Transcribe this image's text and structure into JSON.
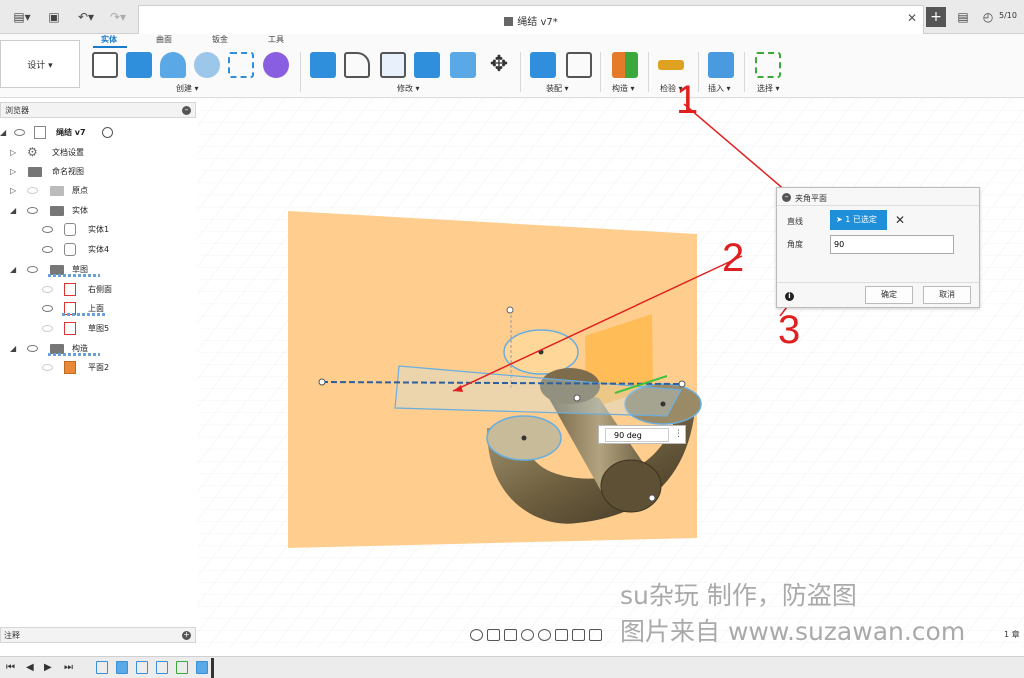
{
  "window": {
    "doc_title": "绳结 v7*",
    "tab_count": "5/10"
  },
  "toolbar": {
    "design_label": "设计 ▾",
    "tabs": [
      "实体",
      "曲面",
      "钣金",
      "工具"
    ],
    "groups": [
      "创建 ▾",
      "修改 ▾",
      "装配 ▾",
      "构造 ▾",
      "检验 ▾",
      "插入 ▾",
      "选择 ▾"
    ]
  },
  "browser": {
    "title": "浏览器",
    "items": [
      {
        "label": "绳结 v7"
      },
      {
        "label": "文档设置"
      },
      {
        "label": "命名视图"
      },
      {
        "label": "原点"
      },
      {
        "label": "实体"
      },
      {
        "label": "实体1"
      },
      {
        "label": "实体4"
      },
      {
        "label": "草图"
      },
      {
        "label": "右侧面"
      },
      {
        "label": "上面"
      },
      {
        "label": "草图5"
      },
      {
        "label": "构造"
      },
      {
        "label": "平面2"
      }
    ]
  },
  "notes": {
    "title": "注释"
  },
  "dialog": {
    "title": "夹角平面",
    "line_label": "直线",
    "selection": "1 已选定",
    "angle_label": "角度",
    "angle_value": "90",
    "ok": "确定",
    "cancel": "取消"
  },
  "viewport": {
    "angle_field": "90 deg"
  },
  "callouts": [
    "1",
    "2",
    "3"
  ],
  "watermark": {
    "line1": "su杂玩 制作，防盗图",
    "line2": "图片来自 www.suzawan.com"
  },
  "page_hint": "1 章",
  "colors": {
    "accent": "#1a7cc9",
    "plane": "#ffc67a",
    "callout": "#e02020",
    "body": "#7a6a48"
  }
}
